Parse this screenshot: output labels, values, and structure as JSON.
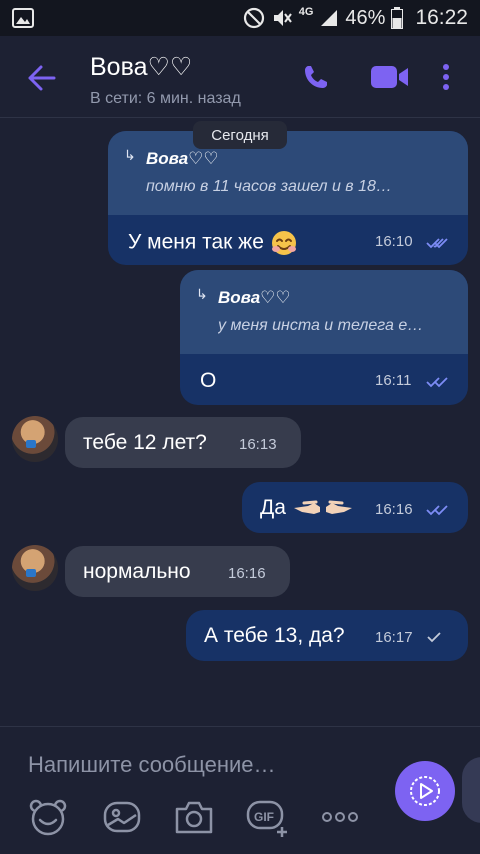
{
  "statusbar": {
    "network": "4G",
    "battery": "46%",
    "time": "16:22"
  },
  "header": {
    "contact_name": "Вова♡♡",
    "status": "В сети: 6 мин. назад",
    "icons": [
      "back-arrow-icon",
      "phone-icon",
      "video-call-icon",
      "more-vertical-icon"
    ],
    "accent_color": "#7d63f2"
  },
  "chat": {
    "date_separator": "Сегодня",
    "messages": [
      {
        "direction": "outgoing",
        "reply_to_name": "Вова♡♡",
        "reply_to_text": "помню в 11 часов зашел и в 18…",
        "text": "У меня так же",
        "emoji": "smiling-face-icon",
        "time": "16:10",
        "status": "read"
      },
      {
        "direction": "outgoing",
        "reply_to_name": "Вова♡♡",
        "reply_to_text": "у меня инста и телега е…",
        "text": "О",
        "time": "16:11",
        "status": "read"
      },
      {
        "direction": "incoming",
        "text": "тебе 12 лет?",
        "time": "16:13"
      },
      {
        "direction": "outgoing",
        "text": "Да",
        "emoji": "pointing-hands-icon",
        "time": "16:16",
        "status": "read"
      },
      {
        "direction": "incoming",
        "text": "нормально",
        "time": "16:16"
      },
      {
        "direction": "outgoing",
        "text": "А тебе 13, да?",
        "time": "16:17",
        "status": "delivered"
      }
    ]
  },
  "composer": {
    "placeholder": "Напишите сообщение…",
    "tools": [
      "sticker-icon",
      "gallery-icon",
      "camera-icon",
      "gif-icon",
      "more-horizontal-icon"
    ],
    "gif_label": "GIF"
  },
  "colors": {
    "background": "#1d2133",
    "outgoing_bubble": "#173266",
    "reply_quote": "#2d4a78",
    "incoming_bubble": "#373c4d",
    "read_ticks": "#7d8cf5"
  }
}
